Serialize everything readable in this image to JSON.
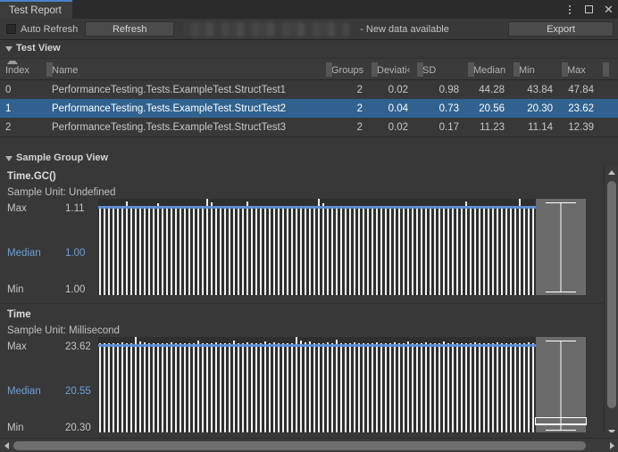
{
  "window": {
    "tab_title": "Test Report",
    "controls": {
      "menu": "kebab-menu",
      "maximize": "maximize",
      "close": "close"
    }
  },
  "toolbar": {
    "auto_refresh_label": "Auto Refresh",
    "auto_refresh_checked": false,
    "refresh_label": "Refresh",
    "search_value": "",
    "status_text": "- New data available",
    "export_label": "Export"
  },
  "test_view": {
    "section_title": "Test View",
    "sort_column": "Index",
    "sort_direction": "ascending",
    "columns": [
      "Index",
      "Name",
      "Groups",
      "Deviati‹",
      "SD",
      "Median",
      "Min",
      "Max",
      ""
    ],
    "rows": [
      {
        "index": "0",
        "name": "PerformanceTesting.Tests.ExampleTest.StructTest1",
        "groups": "2",
        "deviation": "0.02",
        "sd": "0.98",
        "median": "44.28",
        "min": "43.84",
        "max": "47.84",
        "selected": false
      },
      {
        "index": "1",
        "name": "PerformanceTesting.Tests.ExampleTest.StructTest2",
        "groups": "2",
        "deviation": "0.04",
        "sd": "0.73",
        "median": "20.56",
        "min": "20.30",
        "max": "23.62",
        "selected": true
      },
      {
        "index": "2",
        "name": "PerformanceTesting.Tests.ExampleTest.StructTest3",
        "groups": "2",
        "deviation": "0.02",
        "sd": "0.17",
        "median": "11.23",
        "min": "11.14",
        "max": "12.39",
        "selected": false
      }
    ]
  },
  "sample_group_view": {
    "section_title": "Sample Group View",
    "groups": [
      {
        "title": "Time.GC()",
        "unit_label": "Sample Unit: Undefined",
        "max_label": "Max",
        "max_value": "1.11",
        "median_label": "Median",
        "median_value": "1.00",
        "min_label": "Min",
        "min_value": "1.00"
      },
      {
        "title": "Time",
        "unit_label": "Sample Unit: Millisecond",
        "max_label": "Max",
        "max_value": "23.62",
        "median_label": "Median",
        "median_value": "20.55",
        "min_label": "Min",
        "min_value": "20.30"
      }
    ]
  },
  "chart_data": [
    {
      "type": "bar",
      "title": "Time.GC()",
      "xlabel": "",
      "ylabel": "Sample Unit: Undefined",
      "ylim": [
        0,
        1.11
      ],
      "median": 1.0,
      "min": 1.0,
      "max": 1.11,
      "median_line": true,
      "grid": false,
      "legend": "none",
      "values": [
        1.0,
        1.0,
        1.0,
        1.0,
        1.0,
        1.0,
        1.04,
        1.0,
        1.0,
        1.0,
        1.0,
        1.0,
        1.0,
        1.02,
        1.0,
        1.0,
        1.0,
        1.0,
        1.0,
        1.0,
        1.0,
        1.0,
        1.0,
        1.0,
        1.11,
        1.03,
        1.0,
        1.0,
        1.0,
        1.0,
        1.0,
        1.0,
        1.0,
        1.04,
        1.0,
        1.0,
        1.0,
        1.0,
        1.0,
        1.0,
        1.0,
        1.0,
        1.0,
        1.0,
        1.0,
        1.0,
        1.0,
        1.0,
        1.0,
        1.09,
        1.02,
        1.0,
        1.0,
        1.0,
        1.0,
        1.0,
        1.0,
        1.0,
        1.0,
        1.0,
        1.0,
        1.0,
        1.0,
        1.0,
        1.0,
        1.0,
        1.0,
        1.0,
        1.0,
        1.0,
        1.0,
        1.0,
        1.0,
        1.0,
        1.0,
        1.0,
        1.0,
        1.0,
        1.0,
        1.0,
        1.0,
        1.0,
        1.04,
        1.0,
        1.0,
        1.0,
        1.0,
        1.0,
        1.0,
        1.0,
        1.0,
        1.0,
        1.0,
        1.0,
        1.07,
        1.0,
        1.0,
        1.0
      ],
      "box": {
        "min": 1.0,
        "q1": 1.0,
        "median": 1.0,
        "q3": 1.0,
        "max": 1.11
      }
    },
    {
      "type": "bar",
      "title": "Time",
      "xlabel": "",
      "ylabel": "Sample Unit: Millisecond",
      "ylim": [
        0,
        23.62
      ],
      "median": 20.55,
      "min": 20.3,
      "max": 23.62,
      "median_line": true,
      "grid": false,
      "legend": "none",
      "values": [
        20.55,
        20.4,
        20.35,
        20.5,
        20.45,
        20.6,
        20.55,
        20.5,
        22.4,
        20.9,
        20.6,
        20.5,
        20.4,
        20.45,
        20.55,
        20.5,
        20.6,
        20.45,
        20.55,
        20.4,
        20.5,
        20.55,
        21.1,
        20.5,
        20.45,
        20.55,
        20.6,
        20.5,
        20.45,
        20.4,
        21.3,
        20.55,
        20.5,
        20.6,
        20.45,
        20.55,
        20.5,
        21.0,
        20.55,
        20.6,
        20.5,
        20.45,
        20.55,
        20.5,
        23.0,
        21.2,
        20.6,
        20.9,
        20.55,
        20.5,
        20.45,
        20.6,
        20.55,
        21.4,
        20.5,
        20.45,
        20.55,
        20.6,
        20.5,
        20.45,
        20.55,
        20.5,
        20.6,
        20.45,
        20.55,
        20.5,
        20.6,
        20.45,
        20.55,
        21.0,
        20.5,
        20.45,
        20.55,
        20.6,
        20.5,
        20.45,
        20.55,
        20.9,
        20.5,
        20.6,
        20.45,
        20.55,
        20.5,
        20.45,
        20.6,
        20.55,
        20.5,
        20.45,
        20.55,
        20.6,
        20.5,
        20.45,
        20.55,
        20.5,
        20.45,
        20.55,
        20.6,
        20.5
      ],
      "box": {
        "min": 20.3,
        "q1": 20.45,
        "median": 20.55,
        "q3": 20.75,
        "max": 23.62
      }
    }
  ],
  "scrollbars": {
    "vertical": {
      "position": 0.05,
      "size": 0.83
    },
    "horizontal": {
      "position": 0.0,
      "size": 0.95
    }
  },
  "colors": {
    "background": "#383838",
    "panel": "#2f2f2f",
    "selection": "#31628f",
    "accent_blue": "#5b8fd9",
    "median_text": "#6f9fd8",
    "bar": "#f2f2f2",
    "box_zone": "#6b6b6b"
  }
}
